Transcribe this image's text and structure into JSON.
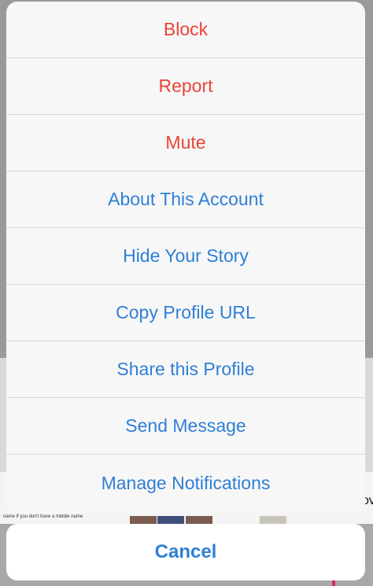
{
  "action_sheet": {
    "items": [
      {
        "label": "Block",
        "style": "destructive"
      },
      {
        "label": "Report",
        "style": "destructive"
      },
      {
        "label": "Mute",
        "style": "destructive"
      },
      {
        "label": "About This Account",
        "style": "default"
      },
      {
        "label": "Hide Your Story",
        "style": "default"
      },
      {
        "label": "Copy Profile URL",
        "style": "default"
      },
      {
        "label": "Share this Profile",
        "style": "default"
      },
      {
        "label": "Send Message",
        "style": "default"
      },
      {
        "label": "Manage Notifications",
        "style": "default"
      }
    ],
    "cancel_label": "Cancel"
  },
  "background": {
    "snippet_text": "name if you don't have a middle name",
    "right_text": "ov"
  },
  "colors": {
    "destructive": "#ea4335",
    "default": "#2f7fd6",
    "sheet_bg": "#f7f7f7"
  }
}
